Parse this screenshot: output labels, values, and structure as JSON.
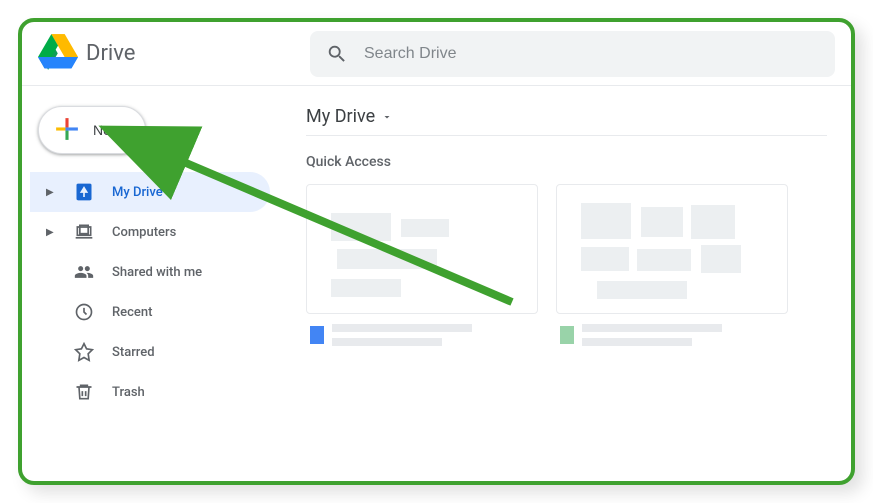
{
  "brand": {
    "name": "Drive"
  },
  "search": {
    "placeholder": "Search Drive"
  },
  "new_button": {
    "label": "New"
  },
  "sidebar": {
    "items": [
      {
        "label": "My Drive"
      },
      {
        "label": "Computers"
      },
      {
        "label": "Shared with me"
      },
      {
        "label": "Recent"
      },
      {
        "label": "Starred"
      },
      {
        "label": "Trash"
      }
    ]
  },
  "breadcrumb": {
    "label": "My Drive"
  },
  "main": {
    "quick_access_title": "Quick Access"
  }
}
